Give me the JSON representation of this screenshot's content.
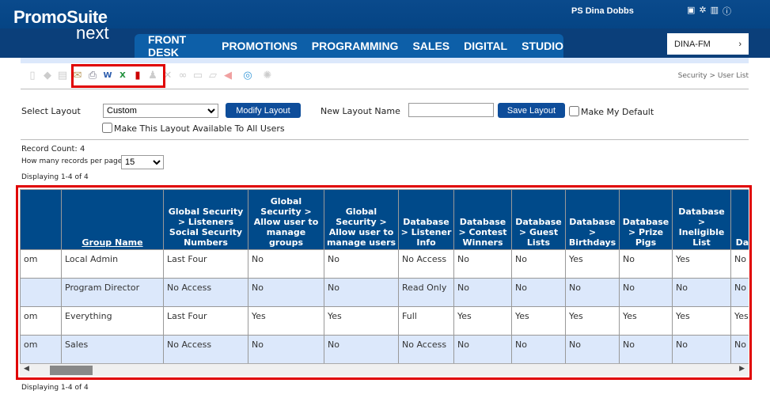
{
  "header": {
    "logo_main": "PromoSuite",
    "logo_sub": "next",
    "user": "PS Dina Dobbs",
    "icons": [
      "user-card-icon",
      "gear-icon",
      "chart-icon",
      "help-icon"
    ],
    "station": "DINA-FM"
  },
  "nav": [
    "FRONT DESK",
    "PROMOTIONS",
    "PROGRAMMING",
    "SALES",
    "DIGITAL",
    "STUDIO"
  ],
  "breadcrumb": "Security > User List",
  "layout": {
    "select_label": "Select Layout",
    "selected": "Custom",
    "modify": "Modify Layout",
    "new_name_label": "New Layout Name",
    "new_name_value": "",
    "save": "Save Layout",
    "default_label": "Make My Default",
    "all_users_label": "Make This Layout Available To All Users"
  },
  "record_count": "Record Count: 4",
  "per_page_label": "How many records per page",
  "per_page": "15",
  "displaying": "Displaying 1-4 of 4",
  "table": {
    "headers": [
      "",
      "Group Name",
      "Global Security > Listeners Social Security Numbers",
      "Global Security > Allow user to manage groups",
      "Global Security > Allow user to manage users",
      "Database > Listener Info",
      "Database > Contest Winners",
      "Database > Guest Lists",
      "Database > Birthdays",
      "Database > Prize Pigs",
      "Database > Ineligible List",
      "Da Dis"
    ],
    "rows": [
      [
        "om",
        "Local Admin",
        "Last Four",
        "No",
        "No",
        "No Access",
        "No",
        "No",
        "Yes",
        "No",
        "Yes",
        "No"
      ],
      [
        "",
        "Program Director",
        "No Access",
        "No",
        "No",
        "Read Only",
        "No",
        "No",
        "No",
        "No",
        "No",
        "No"
      ],
      [
        "om",
        "Everything",
        "Last Four",
        "Yes",
        "Yes",
        "Full",
        "Yes",
        "Yes",
        "Yes",
        "Yes",
        "Yes",
        "Yes"
      ],
      [
        "om",
        "Sales",
        "No Access",
        "No",
        "No",
        "No Access",
        "No",
        "No",
        "No",
        "No",
        "No",
        "No"
      ]
    ]
  }
}
